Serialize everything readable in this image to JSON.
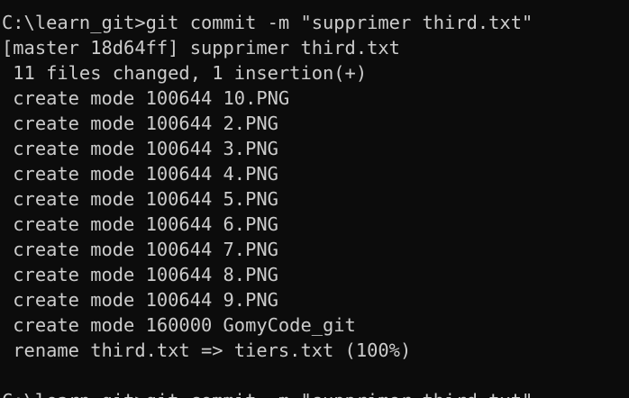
{
  "terminal": {
    "lines": [
      "C:\\learn_git>git commit -m \"supprimer third.txt\"",
      "[master 18d64ff] supprimer third.txt",
      " 11 files changed, 1 insertion(+)",
      " create mode 100644 10.PNG",
      " create mode 100644 2.PNG",
      " create mode 100644 3.PNG",
      " create mode 100644 4.PNG",
      " create mode 100644 5.PNG",
      " create mode 100644 6.PNG",
      " create mode 100644 7.PNG",
      " create mode 100644 8.PNG",
      " create mode 100644 9.PNG",
      " create mode 160000 GomyCode_git",
      " rename third.txt => tiers.txt (100%)",
      "",
      "C:\\learn_git>git commit -m \"supprimer third.txt\""
    ],
    "colors": {
      "background": "#0c0c0c",
      "foreground": "#cccccc"
    }
  }
}
